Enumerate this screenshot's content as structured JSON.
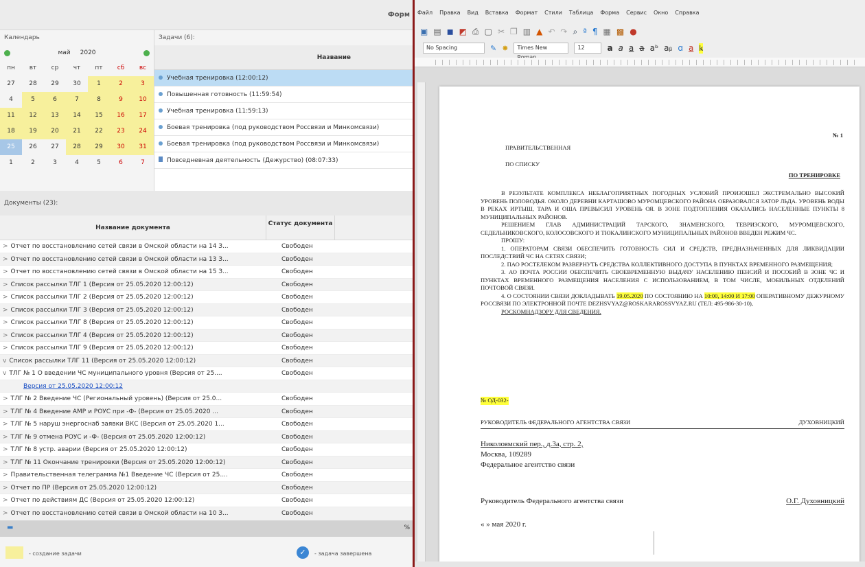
{
  "left": {
    "top_title": "Форм",
    "calendar": {
      "caption": "Календарь",
      "month": "май",
      "year": "2020",
      "dow": [
        "пн",
        "вт",
        "ср",
        "чт",
        "пт",
        "сб",
        "вс"
      ],
      "weeks": [
        [
          "27",
          "28",
          "29",
          "30",
          "1",
          "2",
          "3"
        ],
        [
          "4",
          "5",
          "6",
          "7",
          "8",
          "9",
          "10"
        ],
        [
          "11",
          "12",
          "13",
          "14",
          "15",
          "16",
          "17"
        ],
        [
          "18",
          "19",
          "20",
          "21",
          "22",
          "23",
          "24"
        ],
        [
          "25",
          "26",
          "27",
          "28",
          "29",
          "30",
          "31"
        ],
        [
          "1",
          "2",
          "3",
          "4",
          "5",
          "6",
          "7"
        ]
      ]
    },
    "tasks": {
      "caption": "Задачи (6):",
      "column": "Название",
      "items": [
        "Учебная тренировка (12:00:12)",
        "Повышенная готовность (11:59:54)",
        "Учебная тренировка (11:59:13)",
        "Боевая тренировка (под руководством Россвязи и Минкомсвязи)",
        "Боевая тренировка (под руководством Россвязи и Минкомсвязи)",
        "Повседневная деятельность (Дежурство) (08:07:33)"
      ]
    },
    "docs": {
      "caption": "Документы (23):",
      "col_name": "Название документа",
      "col_status": "Статус документа",
      "rows": [
        {
          "chev": ">",
          "name": "Отчет по восстановлению сетей связи в Омской области на 14 З...",
          "status": "Свободен"
        },
        {
          "chev": ">",
          "name": "Отчет по восстановлению сетей связи в Омской области на 13 З...",
          "status": "Свободен"
        },
        {
          "chev": ">",
          "name": "Отчет по восстановлению сетей связи в Омской области на 15 З...",
          "status": "Свободен"
        },
        {
          "chev": ">",
          "name": "Список рассылки ТЛГ 1 (Версия от 25.05.2020 12:00:12)",
          "status": "Свободен"
        },
        {
          "chev": ">",
          "name": "Список рассылки ТЛГ 2 (Версия от 25.05.2020 12:00:12)",
          "status": "Свободен"
        },
        {
          "chev": ">",
          "name": "Список рассылки ТЛГ 3 (Версия от 25.05.2020 12:00:12)",
          "status": "Свободен"
        },
        {
          "chev": ">",
          "name": "Список рассылки ТЛГ 8 (Версия от 25.05.2020 12:00:12)",
          "status": "Свободен"
        },
        {
          "chev": ">",
          "name": "Список рассылки ТЛГ 4 (Версия от 25.05.2020 12:00:12)",
          "status": "Свободен"
        },
        {
          "chev": ">",
          "name": "Список рассылки ТЛГ 9 (Версия от 25.05.2020 12:00:12)",
          "status": "Свободен"
        },
        {
          "chev": "v",
          "name": "Список рассылки ТЛГ 11 (Версия от 25.05.2020 12:00:12)",
          "status": "Свободен"
        },
        {
          "chev": "v",
          "name": "ТЛГ № 1 О введении ЧС муниципального уровня (Версия от 25....",
          "status": "Свободен"
        },
        {
          "chev": "",
          "name": "Версия от 25.05.2020 12:00:12",
          "status": "",
          "link": true
        },
        {
          "chev": ">",
          "name": "ТЛГ № 2 Введение ЧС (Региональный уровень) (Версия от 25.0...",
          "status": "Свободен"
        },
        {
          "chev": ">",
          "name": "ТЛГ № 4 Введение АМР и РОУС при -Ф- (Версия от 25.05.2020 ...",
          "status": "Свободен"
        },
        {
          "chev": ">",
          "name": "ТЛГ № 5 наруш энергоснаб заявки ВКС (Версия от 25.05.2020 1...",
          "status": "Свободен"
        },
        {
          "chev": ">",
          "name": "ТЛГ № 9 отмена РОУС и -Ф- (Версия от 25.05.2020 12:00:12)",
          "status": "Свободен"
        },
        {
          "chev": ">",
          "name": "ТЛГ № 8 устр. аварии (Версия от 25.05.2020 12:00:12)",
          "status": "Свободен"
        },
        {
          "chev": ">",
          "name": "ТЛГ № 11 Окончание тренировки (Версия от 25.05.2020 12:00:12)",
          "status": "Свободен"
        },
        {
          "chev": ">",
          "name": "Правительственная телеграмма №1 Введение ЧС (Версия от 25....",
          "status": "Свободен"
        },
        {
          "chev": ">",
          "name": "Отчет по ПР (Версия от 25.05.2020 12:00:12)",
          "status": "Свободен"
        },
        {
          "chev": ">",
          "name": "Отчет по действиям ДС (Версия от 25.05.2020 12:00:12)",
          "status": "Свободен"
        },
        {
          "chev": ">",
          "name": "Отчет по восстановлению сетей связи в Омской области на 10 З...",
          "status": "Свободен"
        }
      ]
    },
    "bottom_pct": "%",
    "legend": {
      "create": "- создание задачи",
      "done": "- задача завершена"
    }
  },
  "writer": {
    "menu": [
      "Файл",
      "Правка",
      "Вид",
      "Вставка",
      "Формат",
      "Стили",
      "Таблица",
      "Форма",
      "Сервис",
      "Окно",
      "Справка"
    ],
    "style_combo": "No Spacing",
    "font_combo": "Times New Roman",
    "size_combo": "12",
    "doc": {
      "number": "№ 1",
      "line1": "ПРАВИТЕЛЬСТВЕННАЯ",
      "line2": "ПО СПИСКУ",
      "line3": "ПО ТРЕНИРОВКЕ",
      "para1": "В РЕЗУЛЬТАТЕ КОМПЛЕКСА НЕБЛАГОПРИЯТНЫХ ПОГОДНЫХ УСЛОВИЙ ПРОИЗОШЕЛ ЭКСТРЕМАЛЬНО ВЫСОКИЙ УРОВЕНЬ ПОЛОВОДЬЯ. ОКОЛО ДЕРЕВНИ КАРТАШОВО МУРОМЦЕВСКОГО РАЙОНА ОБРАЗОВАЛСЯ ЗАТОР ЛЬДА. УРОВЕНЬ ВОДЫ В РЕКАХ ИРТЫШ, ТАРА И ОША ПРЕВЫСИЛ УРОВЕНЬ ОЯ. В ЗОНЕ ПОДТОПЛЕНИЯ ОКАЗАЛИСЬ НАСЕЛЕННЫЕ ПУНКТЫ 8 МУНИЦИПАЛЬНЫХ РАЙОНОВ.",
      "para2": "РЕШЕНИЕМ ГЛАВ АДМИНИСТРАЦИЙ ТАРСКОГО, ЗНАМЕНСКОГО, ТЕВРИЗСКОГО, МУРОМЦЕВСКОГО, СЕДЕЛЬНИКОВСКОГО, КОЛОСОВСКОГО И ТЮКАЛИНСКОГО МУНИЦИПАЛЬНЫХ РАЙОНОВ ВВЕДЕН РЕЖИМ ЧС.",
      "para3": "ПРОШУ:",
      "para4": "1. ОПЕРАТОРАМ СВЯЗИ ОБЕСПЕЧИТЬ ГОТОВНОСТЬ СИЛ И СРЕДСТВ, ПРЕДНАЗНАЧЕННЫХ ДЛЯ ЛИКВИДАЦИИ ПОСЛЕДСТВИЙ ЧС НА СЕТЯХ СВЯЗИ;",
      "para5": "2. ПАО РОСТЕЛЕКОМ РАЗВЕРНУТЬ СРЕДСТВА КОЛЛЕКТИВНОГО ДОСТУПА В ПУНКТАХ ВРЕМЕННОГО РАЗМЕЩЕНИЯ;",
      "para6": "3. АО ПОЧТА РОССИИ ОБЕСПЕЧИТЬ СВОЕВРЕМЕННУЮ ВЫДАЧУ НАСЕЛЕНИЮ ПЕНСИЙ И ПОСОБИЙ В ЗОНЕ ЧС И ПУНКТАХ ВРЕМЕННОГО РАЗМЕЩЕНИЯ НАСЕЛЕНИЯ С ИСПОЛЬЗОВАНИЕМ, В ТОМ ЧИСЛЕ, МОБИЛЬНЫХ ОТДЕЛЕНИЙ ПОЧТОВОЙ СВЯЗИ.",
      "para7a": "4. О СОСТОЯНИИ СВЯЗИ ДОКЛАДЫВАТЬ",
      "para7date": "19.05.2020",
      "para7b": "ПО СОСТОЯНИЮ НА",
      "para7times": "10:00, 14:00 И 17:00",
      "para7c": "ОПЕРАТИВНОМУ ДЕЖУРНОМУ РОССВЯЗИ ПО ЭЛЕКТРОННОЙ ПОЧТЕ DEZHSVYAZ@ROSKARAROSSVYAZ.RU (ТЕЛ: 495-986-30-10),",
      "para7d": "РОСКОМНАДЗОРУ ДЛЯ СВЕДЕНИЯ.",
      "code": "№ ОД-032-",
      "head_left": "РУКОВОДИТЕЛЬ ФЕДЕРАЛЬНОГО АГЕНТСТВА СВЯЗИ",
      "head_right": "ДУХОВНИЦКИЙ",
      "addr1": "Николоямский пер., д.3а, стр. 2,",
      "addr2": "Москва, 109289",
      "addr3": "Федеральное агентство связи",
      "sign_left": "Руководитель Федерального агентства связи",
      "sign_right": "О.Г. Духовницкий",
      "date": "« » мая 2020 г."
    }
  }
}
